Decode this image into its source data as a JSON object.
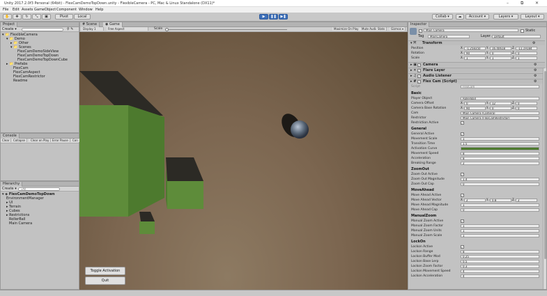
{
  "window": {
    "title": "Unity 2017.2.0f3 Personal (64bit) - FlexCamDemoTopDown.unity - FlexibleCamera - PC, Mac & Linux Standalone (DX11)*",
    "controls": [
      "–",
      "⧉",
      "✕"
    ]
  },
  "menu": [
    "File",
    "Edit",
    "Assets",
    "GameObject",
    "Component",
    "Window",
    "Help"
  ],
  "toolbar": {
    "pivot": "Pivot",
    "local": "Local",
    "collab": "Collab ▾",
    "account": "Account ▾",
    "layers": "Layers ▾",
    "layout": "Layout ▾"
  },
  "project": {
    "tab": "Project",
    "create": "Create ▾",
    "items": [
      "▾ 📁 FlexibleCamera",
      "▾ 📁 Demo",
      "▸ 📁 Other",
      "▾ 📁 Scenes",
      "FlexCamDemoSideView",
      "FlexCamDemoTopDown",
      "FlexCamDemoTopDownCube",
      "▸ 📁 Prefabs",
      "FlexCam",
      "FlexCamAspect",
      "FlexCamRestrictor",
      "Readme"
    ]
  },
  "console": {
    "tab": "Console",
    "buttons": [
      "Clear",
      "Collapse",
      "Clear on Play",
      "Error Pause",
      "Con"
    ]
  },
  "hierarchy": {
    "tab": "Hierarchy",
    "create": "Create ▾",
    "search": "⌕All",
    "scene": "FlexCamDemoTopDown",
    "items": [
      "EnvironmentManager",
      "UI",
      "Terrain",
      "Cubes",
      "Restrictions",
      "RollerBall",
      "Main Camera"
    ]
  },
  "sceneTabs": {
    "scene": "Scene",
    "game": "Game"
  },
  "gameBar": {
    "display": "Display 1",
    "aspect": "Free Aspect",
    "scale": "Scale",
    "maximize": "Maximize On Play",
    "mute": "Mute Audio",
    "stats": "Stats",
    "gizmos": "Gizmos ▾"
  },
  "gameButtons": {
    "toggle": "Toggle Activation",
    "quit": "Quit"
  },
  "inspector": {
    "tab": "Inspector",
    "objName": "Main Camera",
    "static": "Static",
    "tagLabel": "Tag",
    "tag": "MainCamera",
    "layerLabel": "Layer",
    "layer": "Default",
    "transform": {
      "title": "Transform",
      "position": [
        "-1.258350",
        "16.40618",
        "-11.19184"
      ],
      "rotation": [
        "90",
        "0",
        "0"
      ],
      "scale": [
        "1",
        "1",
        "1"
      ],
      "labels": [
        "Position",
        "Rotation",
        "Scale"
      ]
    },
    "components": [
      "Camera",
      "Flare Layer",
      "Audio Listener",
      "Flex Cam (Script)"
    ],
    "scriptLabel": "Script",
    "scriptValue": "FlexCam",
    "rows": [
      {
        "s": "Basic"
      },
      {
        "l": "Player Object",
        "v": "RollerBall"
      },
      {
        "l": "Camera Offset",
        "x": "0",
        "y": "12",
        "z": "0"
      },
      {
        "l": "Camera Base Rotation",
        "x": "90",
        "y": "0",
        "z": "0"
      },
      {
        "l": "Cam",
        "v": "Main Camera (Camera)"
      },
      {
        "l": "Restrictor",
        "v": "Main Camera (FlexCamRestrictor)"
      },
      {
        "l": "Restriction Active",
        "c": "✓"
      },
      {
        "s": "General"
      },
      {
        "l": "General Active",
        "c": "✓"
      },
      {
        "l": "Movement Scale",
        "v": "1"
      },
      {
        "l": "Transition Time",
        "v": "1.5"
      },
      {
        "l": "Activation Curve",
        "curve": 1
      },
      {
        "l": "Movement Speed",
        "v": "8"
      },
      {
        "l": "Acceleration",
        "v": "8"
      },
      {
        "l": "Breaking Range",
        "v": "2"
      },
      {
        "s": "ZoomOut"
      },
      {
        "l": "Zoom Out Active",
        "c": "✓"
      },
      {
        "l": "Zoom Out Magnitude",
        "v": "1.4"
      },
      {
        "l": "Zoom Out Cap",
        "v": "0"
      },
      {
        "s": "MoveAhead"
      },
      {
        "l": "Move Ahead Active",
        "c": "✓"
      },
      {
        "l": "Move Ahead Vector",
        "x": "2",
        "y": "0.8",
        "z": "2"
      },
      {
        "l": "Move Ahead Magnitude",
        "v": "1"
      },
      {
        "l": "Move Ahead Cap",
        "v": "0"
      },
      {
        "s": "ManualZoom"
      },
      {
        "l": "Manual Zoom Active",
        "c": "✓"
      },
      {
        "l": "Manual Zoom Factor",
        "v": "1"
      },
      {
        "l": "Manual Zoom Units",
        "v": "1"
      },
      {
        "l": "Manual Zoom Scale",
        "v": "1"
      },
      {
        "s": "LockOn"
      },
      {
        "l": "Lockon Active",
        "c": "✓"
      },
      {
        "l": "Lockon Range",
        "v": "8"
      },
      {
        "l": "Lockon Buffer Mod",
        "v": "0.25"
      },
      {
        "l": "Lockon Base Lerp",
        "v": "0.5"
      },
      {
        "l": "Lockon Zoom Factor",
        "v": "0.3"
      },
      {
        "l": "Lockon Movement Speed",
        "v": "4"
      },
      {
        "l": "Lockon Acceleration",
        "v": "4"
      }
    ]
  },
  "colors": {
    "accent": "#3d6fb8",
    "cube": "#5e8c3a",
    "cubeTop": "#2c2a25",
    "ground": "#7c6650"
  }
}
